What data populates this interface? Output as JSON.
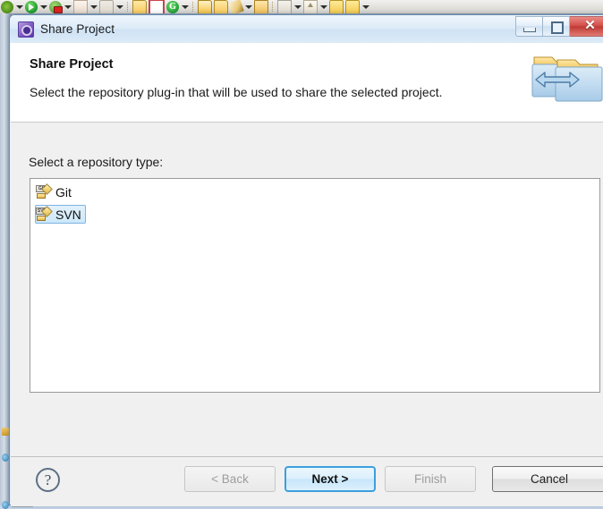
{
  "ide_toolbar": {
    "icons": [
      {
        "name": "debug-bug-icon",
        "cls": "ico-bug"
      },
      {
        "name": "run-icon",
        "cls": "ico-run"
      },
      {
        "name": "external-tools-icon",
        "cls": "ico-ant"
      },
      {
        "name": "new-page-icon",
        "cls": "ico-page"
      },
      {
        "name": "build-tool-icon",
        "cls": "ico-tool"
      },
      {
        "name": "open-perspective-icon",
        "cls": "ico-open"
      },
      {
        "name": "new-wizard-icon",
        "cls": "ico-grid"
      },
      {
        "name": "google-icon",
        "cls": "ico-g",
        "glyph": "G"
      },
      {
        "name": "open-folder-icon",
        "cls": "ico-open2"
      },
      {
        "name": "open-folder-alt-icon",
        "cls": "ico-open"
      },
      {
        "name": "edit-pencil-icon",
        "cls": "ico-pencil"
      },
      {
        "name": "envelope-icon",
        "cls": "ico-env"
      },
      {
        "name": "key-icon",
        "cls": "ico-key"
      },
      {
        "name": "upload-icon",
        "cls": "ico-up"
      },
      {
        "name": "back-arrow-icon",
        "cls": "ico-back"
      },
      {
        "name": "forward-arrow-icon",
        "cls": "ico-back"
      }
    ]
  },
  "window": {
    "title": "Share Project",
    "icon": "share-project-gear-icon",
    "controls": {
      "minimize": "minimize-button",
      "maximize": "maximize-button",
      "close_glyph": "✕"
    }
  },
  "header": {
    "title": "Share Project",
    "description": "Select the repository plug-in that will be used to share the selected project.",
    "banner_icon": "shared-folders-icon"
  },
  "main": {
    "list_label": "Select a repository type:",
    "items": [
      {
        "label": "Git",
        "icon_text": "GIT",
        "icon": "git-repository-icon",
        "selected": false
      },
      {
        "label": "SVN",
        "icon_text": "SVN",
        "icon": "svn-repository-icon",
        "selected": true
      }
    ]
  },
  "footer": {
    "help_glyph": "?",
    "buttons": [
      {
        "id": "btn-back",
        "name": "back-button",
        "label": "< Back",
        "state": "disabled"
      },
      {
        "id": "btn-next",
        "name": "next-button",
        "label": "Next >",
        "state": "primary"
      },
      {
        "id": "btn-finish",
        "name": "finish-button",
        "label": "Finish",
        "state": "disabled"
      },
      {
        "id": "btn-cancel",
        "name": "cancel-button",
        "label": "Cancel",
        "state": "strong"
      }
    ]
  },
  "colors": {
    "accent": "#3c9fdc",
    "selection_border": "#7eb4e2",
    "close_red": "#c03b35",
    "dialog_bg": "#f0f0f0"
  }
}
